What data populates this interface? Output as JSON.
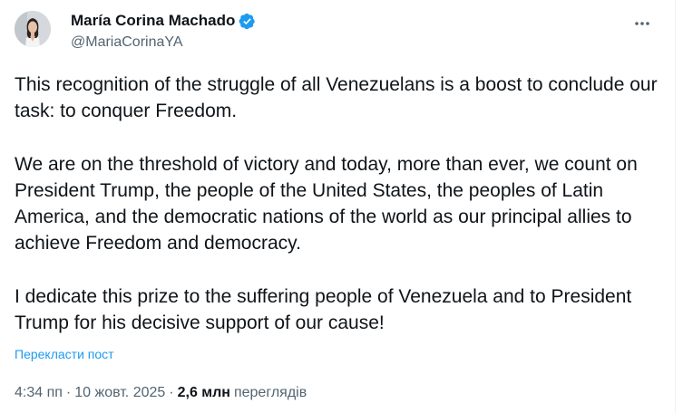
{
  "author": {
    "display_name": "María Corina Machado",
    "handle": "@MariaCorinaYA",
    "verified": true
  },
  "tweet": {
    "paragraphs": [
      "This recognition of the struggle of all Venezuelans is a boost to conclude our task: to conquer Freedom.",
      "We are on the threshold of victory and today, more than ever, we count on President Trump, the people of the United States, the peoples of Latin America, and the democratic nations of the world as our principal allies to achieve Freedom and democracy.",
      "I dedicate this prize to the suffering people of Venezuela and to President Trump for his decisive support of our cause!"
    ],
    "translate_label": "Перекласти пост"
  },
  "meta": {
    "time": "4:34 пп",
    "separator": "·",
    "date": "10 жовт. 2025",
    "views_count": "2,6 млн",
    "views_label": "переглядів"
  },
  "icons": {
    "verified": "verified-badge-icon",
    "more": "more-options-icon"
  },
  "colors": {
    "accent": "#1d9bf0",
    "text_primary": "#0f1419",
    "text_secondary": "#536471"
  }
}
